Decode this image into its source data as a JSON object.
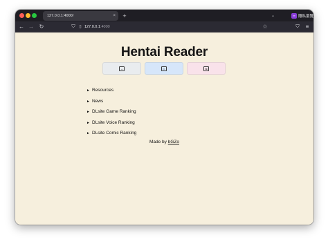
{
  "browser": {
    "tab_title": "127.0.0.1:4000/",
    "tab_close": "×",
    "new_tab": "+",
    "tab_list": "⌄",
    "url_host": "127.0.0.1",
    "url_port": ":4000",
    "extension_label": "隱私瀏覽"
  },
  "page": {
    "title": "Hentai Reader",
    "mode_buttons": [
      "↔",
      "▷",
      "⇆"
    ],
    "menu": [
      {
        "label": "Resources"
      },
      {
        "label": "News"
      },
      {
        "label": "DLsite Game Ranking"
      },
      {
        "label": "DLsite Voice Ranking"
      },
      {
        "label": "DLsite Comic Ranking"
      }
    ],
    "credit_prefix": "Made by ",
    "credit_author": "bGZo"
  },
  "icons": {
    "caret": "►"
  }
}
